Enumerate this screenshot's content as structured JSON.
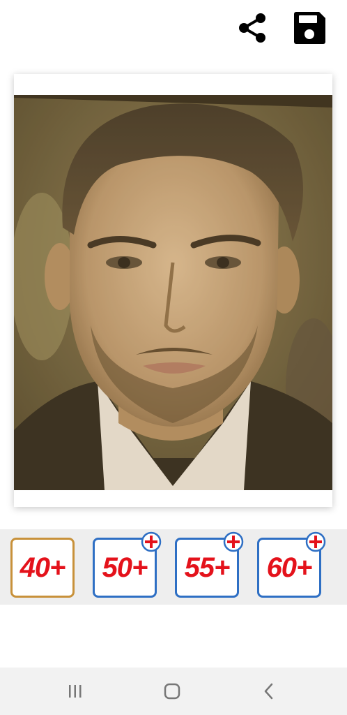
{
  "toolbar": {
    "share_icon": "share-icon",
    "save_icon": "save-icon"
  },
  "photo": {
    "description_icon": "portrait-photo"
  },
  "age_filters": [
    {
      "label": "40+",
      "state": "selected",
      "border_color": "#c8913a"
    },
    {
      "label": "50+",
      "state": "locked",
      "badge_icon": "plus-icon",
      "border_color": "#2e6fc4"
    },
    {
      "label": "55+",
      "state": "locked",
      "badge_icon": "plus-icon",
      "border_color": "#2e6fc4"
    },
    {
      "label": "60+",
      "state": "locked",
      "badge_icon": "plus-icon",
      "border_color": "#2e6fc4"
    }
  ],
  "colors": {
    "label_red": "#e4121b",
    "accent_blue": "#2e6fc4",
    "selected_gold": "#c8913a"
  },
  "navbar": {
    "recents_icon": "recents-icon",
    "home_icon": "home-icon",
    "back_icon": "back-icon"
  }
}
